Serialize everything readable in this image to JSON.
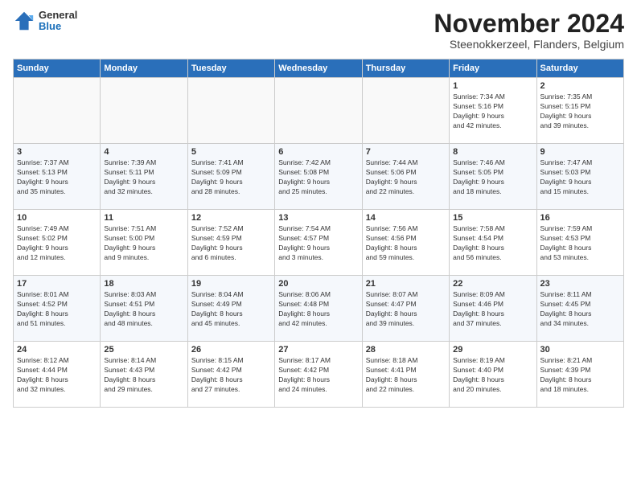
{
  "header": {
    "logo": {
      "general": "General",
      "blue": "Blue"
    },
    "month": "November 2024",
    "location": "Steenokkerzeel, Flanders, Belgium"
  },
  "weekdays": [
    "Sunday",
    "Monday",
    "Tuesday",
    "Wednesday",
    "Thursday",
    "Friday",
    "Saturday"
  ],
  "weeks": [
    [
      {
        "day": "",
        "info": ""
      },
      {
        "day": "",
        "info": ""
      },
      {
        "day": "",
        "info": ""
      },
      {
        "day": "",
        "info": ""
      },
      {
        "day": "",
        "info": ""
      },
      {
        "day": "1",
        "info": "Sunrise: 7:34 AM\nSunset: 5:16 PM\nDaylight: 9 hours\nand 42 minutes."
      },
      {
        "day": "2",
        "info": "Sunrise: 7:35 AM\nSunset: 5:15 PM\nDaylight: 9 hours\nand 39 minutes."
      }
    ],
    [
      {
        "day": "3",
        "info": "Sunrise: 7:37 AM\nSunset: 5:13 PM\nDaylight: 9 hours\nand 35 minutes."
      },
      {
        "day": "4",
        "info": "Sunrise: 7:39 AM\nSunset: 5:11 PM\nDaylight: 9 hours\nand 32 minutes."
      },
      {
        "day": "5",
        "info": "Sunrise: 7:41 AM\nSunset: 5:09 PM\nDaylight: 9 hours\nand 28 minutes."
      },
      {
        "day": "6",
        "info": "Sunrise: 7:42 AM\nSunset: 5:08 PM\nDaylight: 9 hours\nand 25 minutes."
      },
      {
        "day": "7",
        "info": "Sunrise: 7:44 AM\nSunset: 5:06 PM\nDaylight: 9 hours\nand 22 minutes."
      },
      {
        "day": "8",
        "info": "Sunrise: 7:46 AM\nSunset: 5:05 PM\nDaylight: 9 hours\nand 18 minutes."
      },
      {
        "day": "9",
        "info": "Sunrise: 7:47 AM\nSunset: 5:03 PM\nDaylight: 9 hours\nand 15 minutes."
      }
    ],
    [
      {
        "day": "10",
        "info": "Sunrise: 7:49 AM\nSunset: 5:02 PM\nDaylight: 9 hours\nand 12 minutes."
      },
      {
        "day": "11",
        "info": "Sunrise: 7:51 AM\nSunset: 5:00 PM\nDaylight: 9 hours\nand 9 minutes."
      },
      {
        "day": "12",
        "info": "Sunrise: 7:52 AM\nSunset: 4:59 PM\nDaylight: 9 hours\nand 6 minutes."
      },
      {
        "day": "13",
        "info": "Sunrise: 7:54 AM\nSunset: 4:57 PM\nDaylight: 9 hours\nand 3 minutes."
      },
      {
        "day": "14",
        "info": "Sunrise: 7:56 AM\nSunset: 4:56 PM\nDaylight: 8 hours\nand 59 minutes."
      },
      {
        "day": "15",
        "info": "Sunrise: 7:58 AM\nSunset: 4:54 PM\nDaylight: 8 hours\nand 56 minutes."
      },
      {
        "day": "16",
        "info": "Sunrise: 7:59 AM\nSunset: 4:53 PM\nDaylight: 8 hours\nand 53 minutes."
      }
    ],
    [
      {
        "day": "17",
        "info": "Sunrise: 8:01 AM\nSunset: 4:52 PM\nDaylight: 8 hours\nand 51 minutes."
      },
      {
        "day": "18",
        "info": "Sunrise: 8:03 AM\nSunset: 4:51 PM\nDaylight: 8 hours\nand 48 minutes."
      },
      {
        "day": "19",
        "info": "Sunrise: 8:04 AM\nSunset: 4:49 PM\nDaylight: 8 hours\nand 45 minutes."
      },
      {
        "day": "20",
        "info": "Sunrise: 8:06 AM\nSunset: 4:48 PM\nDaylight: 8 hours\nand 42 minutes."
      },
      {
        "day": "21",
        "info": "Sunrise: 8:07 AM\nSunset: 4:47 PM\nDaylight: 8 hours\nand 39 minutes."
      },
      {
        "day": "22",
        "info": "Sunrise: 8:09 AM\nSunset: 4:46 PM\nDaylight: 8 hours\nand 37 minutes."
      },
      {
        "day": "23",
        "info": "Sunrise: 8:11 AM\nSunset: 4:45 PM\nDaylight: 8 hours\nand 34 minutes."
      }
    ],
    [
      {
        "day": "24",
        "info": "Sunrise: 8:12 AM\nSunset: 4:44 PM\nDaylight: 8 hours\nand 32 minutes."
      },
      {
        "day": "25",
        "info": "Sunrise: 8:14 AM\nSunset: 4:43 PM\nDaylight: 8 hours\nand 29 minutes."
      },
      {
        "day": "26",
        "info": "Sunrise: 8:15 AM\nSunset: 4:42 PM\nDaylight: 8 hours\nand 27 minutes."
      },
      {
        "day": "27",
        "info": "Sunrise: 8:17 AM\nSunset: 4:42 PM\nDaylight: 8 hours\nand 24 minutes."
      },
      {
        "day": "28",
        "info": "Sunrise: 8:18 AM\nSunset: 4:41 PM\nDaylight: 8 hours\nand 22 minutes."
      },
      {
        "day": "29",
        "info": "Sunrise: 8:19 AM\nSunset: 4:40 PM\nDaylight: 8 hours\nand 20 minutes."
      },
      {
        "day": "30",
        "info": "Sunrise: 8:21 AM\nSunset: 4:39 PM\nDaylight: 8 hours\nand 18 minutes."
      }
    ]
  ]
}
